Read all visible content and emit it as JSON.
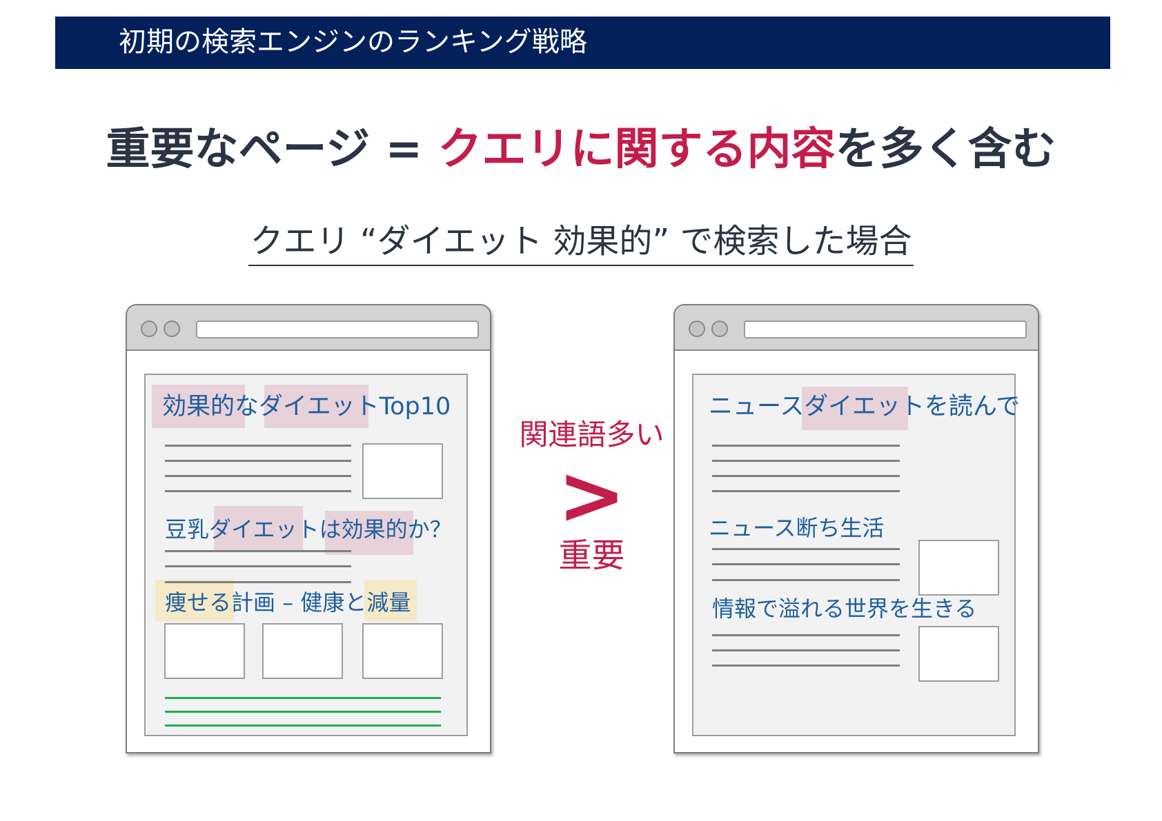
{
  "header": {
    "title": "初期の検索エンジンのランキング戦略"
  },
  "headline": {
    "part1": "重要なページ = ",
    "highlight": "クエリに関する内容",
    "part2": "を多く含む"
  },
  "subtitle": "クエリ “ダイエット 効果的” で検索した場合",
  "left_page": {
    "heading1": "効果的なダイエットTop10",
    "heading2": "豆乳ダイエットは効果的か？",
    "heading3": "痩せる計画 – 健康と減量"
  },
  "comparison": {
    "top_label": "関連語多い",
    "symbol": ">",
    "bottom_label": "重要"
  },
  "right_page": {
    "heading1": "ニュースダイエットを読んで",
    "heading2": "ニュース断ち生活",
    "heading3": "情報で溢れる世界を生きる"
  },
  "colors": {
    "header_bg": "#03205b",
    "accent": "#c31d4b",
    "dark_text": "#2b3345",
    "page_text": "#1f5f9e",
    "highlight_pink": "#e8d2da",
    "highlight_yellow": "#f5eac8",
    "green_line": "#19b050"
  }
}
